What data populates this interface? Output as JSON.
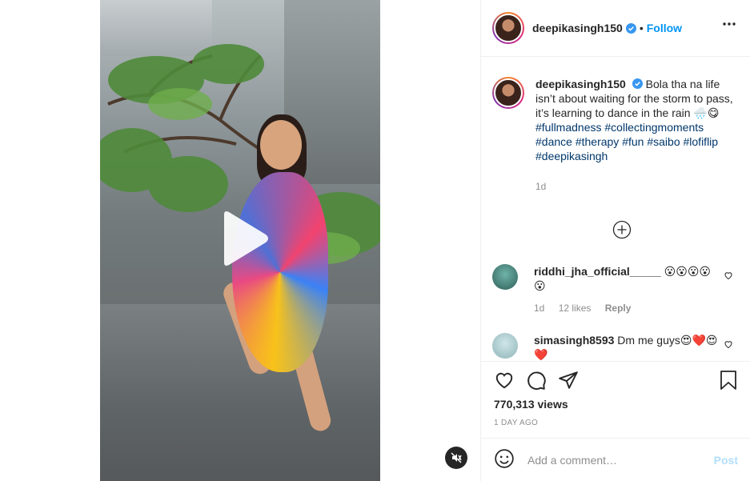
{
  "post": {
    "username": "deepikasingh150",
    "follow_label": "Follow",
    "dot": "•",
    "caption": {
      "text": "Bola tha na life isn’t about waiting for the storm to pass, it’s learning to dance in the rain 🌧️😋",
      "hashtags": [
        "#fullmadness",
        "#collectingmoments",
        "#dance",
        "#therapy",
        "#fun",
        "#saibo",
        "#lofiflip",
        "#deepikasingh"
      ],
      "time": "1d"
    },
    "comments": [
      {
        "username": "riddhi_jha_official_____",
        "text": "😮😮😮😮😮",
        "time": "1d",
        "likes": "12 likes",
        "reply": "Reply"
      },
      {
        "username": "simasingh8593",
        "text": "Dm me guys😍❤️😍❤️"
      }
    ],
    "views": "770,313 views",
    "posted_ago": "1 DAY AGO",
    "comment_placeholder": "Add a comment…",
    "post_label": "Post"
  },
  "colors": {
    "accent": "#0095f6",
    "verified": "#3897f0",
    "post_disabled": "#b2dffc"
  },
  "icons": [
    "verified-badge-icon",
    "more-options-icon",
    "add-comment-plus-icon",
    "heart-icon",
    "comment-icon",
    "share-icon",
    "save-bookmark-icon",
    "emoji-icon",
    "play-icon",
    "mute-icon"
  ]
}
